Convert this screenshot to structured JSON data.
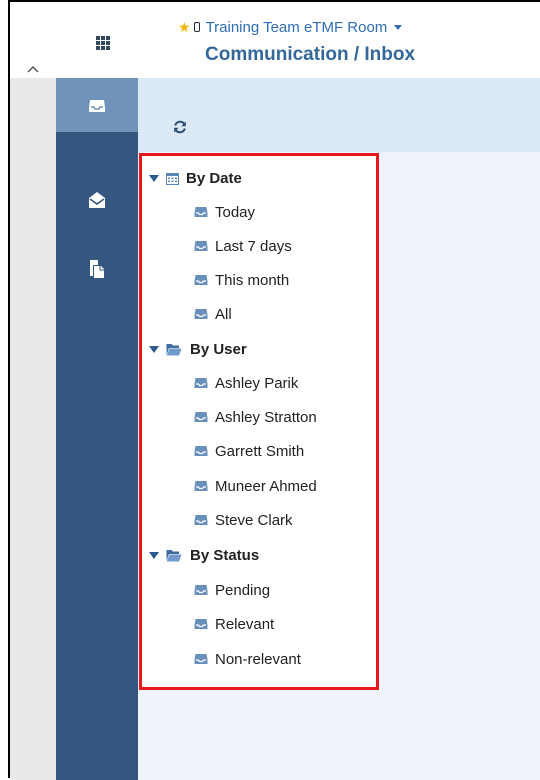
{
  "header": {
    "room_name": "Training Team eTMF Room",
    "page_title": "Communication / Inbox"
  },
  "colors": {
    "nav_bar": "#34577f",
    "nav_active": "#6f93b9",
    "highlight_border": "#e8171d",
    "link_blue": "#2f6db5"
  },
  "nav": {
    "items": [
      {
        "icon": "inbox-tray-icon",
        "active": true
      },
      {
        "icon": "envelope-open-icon",
        "active": false
      },
      {
        "icon": "documents-icon",
        "active": false
      }
    ]
  },
  "toolbar": {
    "refresh_icon": "refresh-icon"
  },
  "tree": {
    "by_date": {
      "label": "By Date",
      "items": [
        "Today",
        "Last 7 days",
        "This month",
        "All"
      ]
    },
    "by_user": {
      "label": "By User",
      "items": [
        "Ashley Parik",
        "Ashley Stratton",
        "Garrett Smith",
        "Muneer Ahmed",
        "Steve Clark"
      ]
    },
    "by_status": {
      "label": "By Status",
      "items": [
        "Pending",
        "Relevant",
        "Non-relevant"
      ]
    }
  }
}
